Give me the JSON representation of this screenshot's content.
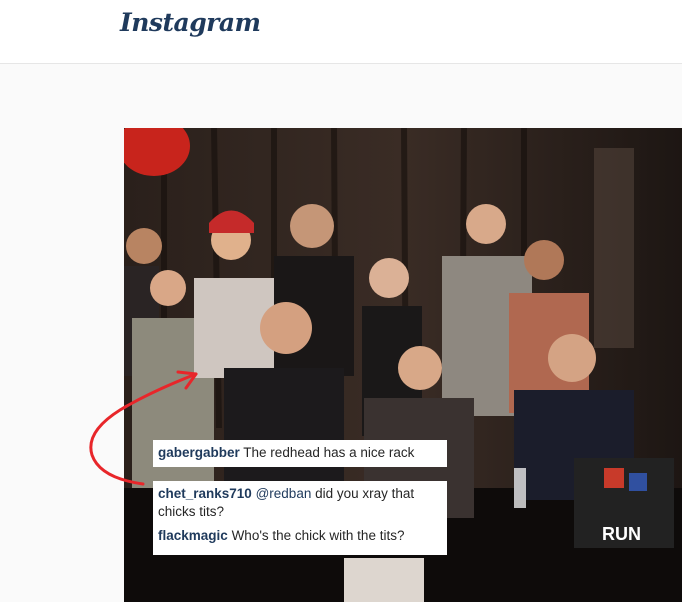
{
  "header": {
    "logo_text": "Instagram"
  },
  "photo": {
    "description_icon": "group-photo-image",
    "banner_text": "RUN"
  },
  "comments": [
    {
      "user": "gabergabber",
      "text": "The redhead has a nice rack"
    },
    {
      "user": "chet_ranks710",
      "mention": "@redban",
      "text": "did you xray that chicks tits?"
    },
    {
      "user": "flackmagic",
      "text": "Who's the chick with the tits?"
    }
  ],
  "colors": {
    "username": "#1f3a5c",
    "annotation": "#e8262a"
  }
}
